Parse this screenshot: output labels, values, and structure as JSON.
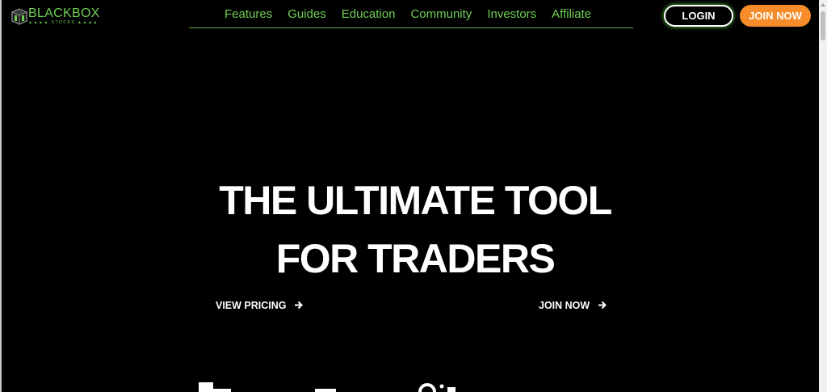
{
  "header": {
    "logo": {
      "text": "BLACKBOX",
      "sub": "▲▲▲▲ STOCKS ▲▲▲▲",
      "icon": "cube-logo-icon"
    },
    "nav": [
      {
        "label": "Features"
      },
      {
        "label": "Guides"
      },
      {
        "label": "Education"
      },
      {
        "label": "Community"
      },
      {
        "label": "Investors"
      },
      {
        "label": "Affiliate"
      }
    ],
    "login_label": "LOGIN",
    "join_label": "JOIN NOW"
  },
  "hero": {
    "title_line1": "THE ULTIMATE TOOL",
    "title_line2": "FOR TRADERS",
    "cta_pricing": "VIEW PRICING",
    "cta_join": "JOIN NOW",
    "arrow_icon": "arrow-right-icon"
  },
  "colors": {
    "background": "#000000",
    "accent_green": "#6fd054",
    "join_orange": "#f68d2a",
    "text": "#ffffff"
  }
}
